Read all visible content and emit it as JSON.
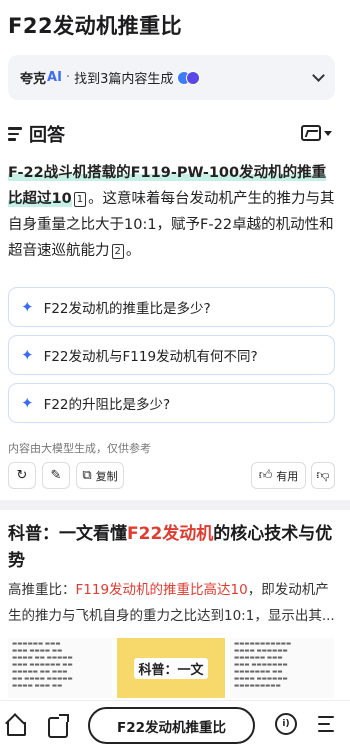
{
  "query": "F22发动机推重比",
  "source_bar": {
    "brand": "夸克",
    "ai": "AI",
    "dot": "·",
    "text": "找到3篇内容生成"
  },
  "answer": {
    "heading": "回答",
    "bold_text": "F-22战斗机搭载的F119-PW-100发动机的推重比超过10",
    "cite1": "1",
    "rest_text": "。这意味着每台发动机产生的推力与其自身重量之比大于10:1，赋予F-22卓越的机动性和超音速巡航能力",
    "cite2": "2",
    "end": "。"
  },
  "suggestions": [
    "F22发动机的推重比是多少?",
    "F22发动机与F119发动机有何不同?",
    "F22的升阻比是多少?"
  ],
  "disclaimer": "内容由大模型生成，仅供参考",
  "actions": {
    "copy": "复制",
    "useful": "有用"
  },
  "article": {
    "title_pre": "科普：一文看懂",
    "title_red": "F22发动机",
    "title_post": "的核心技术与优势",
    "body_pre": "高推重比：",
    "body_red": "F119发动机的推重比高达10",
    "body_post": "，即发动机产生的推力与飞机自身的重力之比达到10:1，显示出其...",
    "thumb_center": "科普：一文"
  },
  "bottom_bar": {
    "search": "F22发动机推重比",
    "voice_label": "i)"
  }
}
